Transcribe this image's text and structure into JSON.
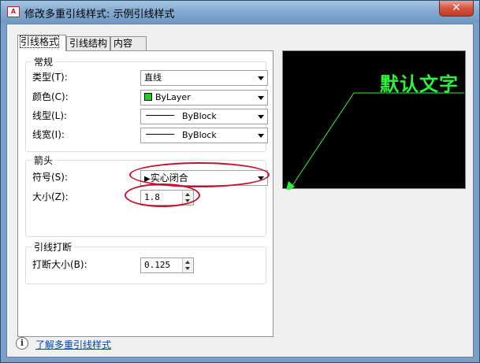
{
  "window": {
    "title": "修改多重引线样式: 示例引线样式",
    "app_icon": "A",
    "close_label": "✕",
    "accent_color": "#2ef23a",
    "highlight_color": "#c8102e"
  },
  "tabs": [
    {
      "label": "引线格式",
      "active": true
    },
    {
      "label": "引线结构",
      "active": false
    },
    {
      "label": "内容",
      "active": false
    }
  ],
  "general": {
    "title": "常规",
    "type_label": "类型(T):",
    "type_value": "直线",
    "color_label": "颜色(C):",
    "color_value": "ByLayer",
    "color_swatch": "#1cd11c",
    "linetype_label": "线型(L):",
    "linetype_value": "ByBlock",
    "lineweight_label": "线宽(I):",
    "lineweight_value": "ByBlock"
  },
  "arrowhead": {
    "title": "箭头",
    "symbol_label": "符号(S):",
    "symbol_value": "实心闭合",
    "size_label": "大小(Z):",
    "size_value": "1.8"
  },
  "break": {
    "title": "引线打断",
    "size_label": "打断大小(B):",
    "size_value": "0.125"
  },
  "preview": {
    "text": "默认文字"
  },
  "footer": {
    "info_icon": "info-icon",
    "info_glyph": "i",
    "help_link": "了解多重引线样式"
  }
}
